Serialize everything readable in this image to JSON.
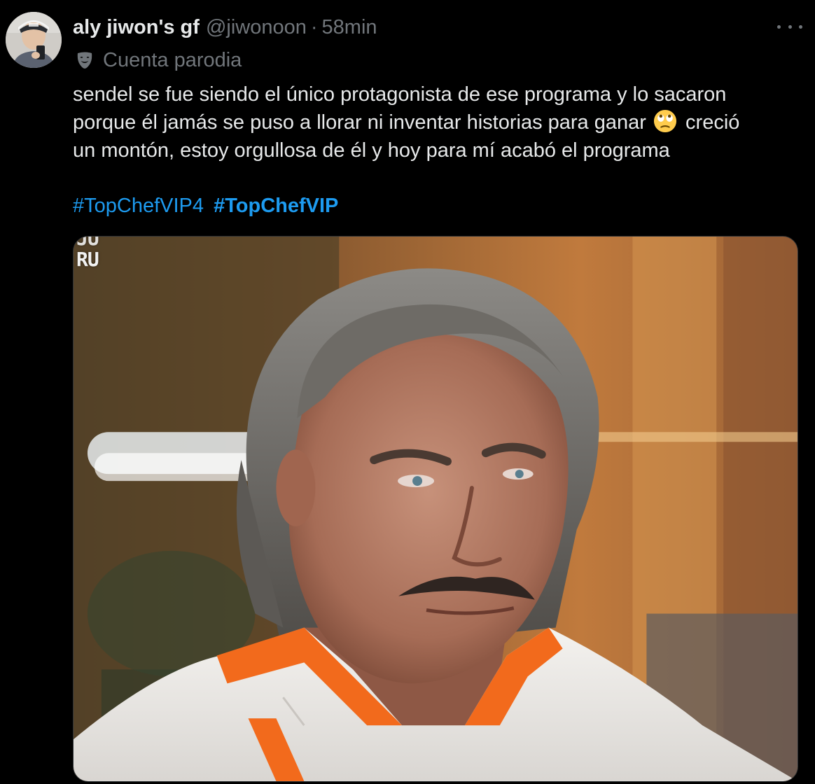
{
  "post": {
    "display_name": "aly jiwon's gf",
    "handle": "@jiwonoon",
    "separator": "·",
    "time": "58min",
    "label": "Cuenta parodia",
    "label_icon": "theater-mask-icon",
    "body_lines": [
      "sendel se fue siendo el único protagonista de ese programa y lo sacaron",
      "porque él jamás se puso a llorar ni inventar historias para ganar",
      "creció",
      "un montón, estoy orgullosa de él y hoy para mí acabó el programa"
    ],
    "emoji": "face-with-rolling-eyes-icon",
    "hashtags": [
      "#TopChefVIP4",
      "#TopChefVIP"
    ],
    "media": {
      "watermark_top": "JU",
      "watermark_bottom": "RU"
    }
  },
  "colors": {
    "background": "#000000",
    "text": "#e7e9ea",
    "secondary": "#71767b",
    "link": "#1d9bf0",
    "jacket_accent": "#f26a1c"
  }
}
